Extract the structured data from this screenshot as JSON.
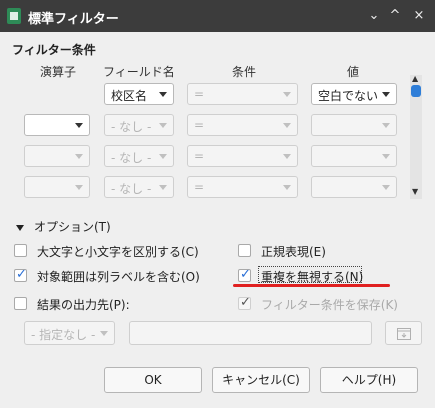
{
  "window": {
    "title": "標準フィルター",
    "minimize_glyph": "⌄",
    "maximize_glyph": "^",
    "close_glyph": "×"
  },
  "conditions": {
    "section_title": "フィルター条件",
    "headers": {
      "operator": "演算子",
      "field": "フィールド名",
      "condition": "条件",
      "value": "値"
    },
    "rows": [
      {
        "operator": "",
        "field": "校区名",
        "condition": "=",
        "value": "空白でない"
      },
      {
        "operator": "",
        "field": "- なし -",
        "condition": "=",
        "value": ""
      },
      {
        "operator": "",
        "field": "- なし -",
        "condition": "=",
        "value": ""
      },
      {
        "operator": "",
        "field": "- なし -",
        "condition": "=",
        "value": ""
      }
    ]
  },
  "options": {
    "expander_label": "オプション(T)",
    "case_sensitive": {
      "label": "大文字と小文字を区別する(C)",
      "checked": false
    },
    "regex": {
      "label": "正規表現(E)",
      "checked": false
    },
    "range_has_headers": {
      "label": "対象範囲は列ラベルを含む(O)",
      "checked": true
    },
    "no_duplicates": {
      "label": "重複を無視する(N)",
      "checked": true
    },
    "copy_results": {
      "label": "結果の出力先(P):",
      "checked": false
    },
    "keep_criteria": {
      "label": "フィルター条件を保存(K)",
      "checked": true
    },
    "output_select": "- 指定なし -",
    "output_input": ""
  },
  "buttons": {
    "ok": "OK",
    "cancel": "キャンセル(C)",
    "help": "ヘルプ(H)"
  },
  "colors": {
    "accent": "#2f7ed8",
    "annotation": "#e02020",
    "titlebar": "#3c3c3c"
  }
}
